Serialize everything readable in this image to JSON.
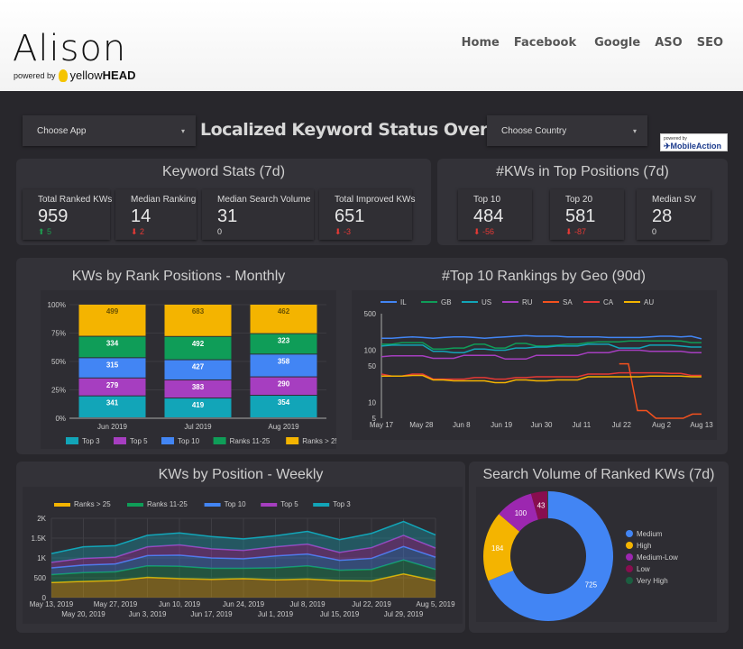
{
  "header": {
    "logo": "Alison",
    "powered_by": "powered by",
    "brand_light": "yellow",
    "brand_bold": "HEAD",
    "nav": [
      "Home",
      "Facebook",
      "Google",
      "ASO",
      "SEO"
    ]
  },
  "controls": {
    "choose_app": "Choose App",
    "title": "Localized Keyword Status Overview",
    "choose_country": "Choose Country",
    "caret": "▾",
    "badge_small": "powered by",
    "badge": "MobileAction"
  },
  "keyword_stats": {
    "title": "Keyword Stats (7d)",
    "cards": [
      {
        "label": "Total Ranked KWs",
        "value": "959",
        "delta": "5",
        "dir": "up"
      },
      {
        "label": "Median Ranking",
        "value": "14",
        "delta": "2",
        "dir": "down"
      },
      {
        "label": "Median Search Volume",
        "value": "31",
        "delta": "0",
        "dir": "neutral"
      },
      {
        "label": "Total Improved KWs",
        "value": "651",
        "delta": "-3",
        "dir": "down"
      }
    ]
  },
  "top_positions": {
    "title": "#KWs in Top Positions (7d)",
    "cards": [
      {
        "label": "Top 10",
        "value": "484",
        "delta": "-56",
        "dir": "down"
      },
      {
        "label": "Top 20",
        "value": "581",
        "delta": "-87",
        "dir": "down"
      },
      {
        "label": "Median SV",
        "value": "28",
        "delta": "0",
        "dir": "neutral"
      }
    ]
  },
  "titles": {
    "monthly": "KWs by Rank Positions - Monthly",
    "geo": "#Top 10 Rankings by Geo (90d)",
    "weekly": "KWs by Position - Weekly",
    "sv": "Search Volume of Ranked KWs (7d)"
  },
  "chart_data": [
    {
      "type": "bar",
      "stacked": "percent",
      "title": "KWs by Rank Positions - Monthly",
      "categories": [
        "Jun 2019",
        "Jul 2019",
        "Aug 2019"
      ],
      "yticks": [
        "0%",
        "25%",
        "50%",
        "75%",
        "100%"
      ],
      "series": [
        {
          "name": "Top 3",
          "color": "#12a5b8",
          "values": [
            341,
            419,
            354
          ]
        },
        {
          "name": "Top 5",
          "color": "#a63ec0",
          "values": [
            279,
            383,
            290
          ]
        },
        {
          "name": "Top 10",
          "color": "#4285f4",
          "values": [
            315,
            427,
            358
          ]
        },
        {
          "name": "Ranks 11-25",
          "color": "#0f9d58",
          "values": [
            334,
            492,
            323
          ]
        },
        {
          "name": "Ranks > 25",
          "color": "#f4b400",
          "values": [
            499,
            683,
            462
          ]
        }
      ],
      "legend": "bottom"
    },
    {
      "type": "line",
      "title": "#Top 10 Rankings by Geo (90d)",
      "yscale": "log",
      "ylim": [
        5,
        500
      ],
      "yticks": [
        5,
        10,
        50,
        100,
        500
      ],
      "xticks": [
        "May 17",
        "May 28",
        "Jun 8",
        "Jun 19",
        "Jun 30",
        "Jul 11",
        "Jul 22",
        "Aug 2",
        "Aug 13"
      ],
      "series": [
        {
          "name": "IL",
          "color": "#4285f4",
          "values": [
            170,
            170,
            175,
            180,
            175,
            170,
            175,
            180,
            180,
            175,
            170,
            175,
            180,
            185,
            190,
            185,
            185,
            185,
            180,
            180,
            180,
            180,
            175,
            175,
            175,
            175,
            180,
            185,
            185,
            180,
            185,
            165
          ]
        },
        {
          "name": "GB",
          "color": "#0f9d58",
          "values": [
            130,
            130,
            140,
            140,
            140,
            105,
            105,
            110,
            110,
            130,
            130,
            110,
            110,
            135,
            135,
            120,
            120,
            125,
            130,
            130,
            140,
            145,
            145,
            145,
            150,
            150,
            150,
            150,
            150,
            150,
            140,
            140
          ]
        },
        {
          "name": "US",
          "color": "#12a5b8",
          "values": [
            120,
            125,
            125,
            125,
            125,
            95,
            95,
            90,
            90,
            105,
            105,
            100,
            100,
            110,
            110,
            115,
            115,
            120,
            120,
            120,
            130,
            130,
            130,
            110,
            110,
            110,
            125,
            125,
            125,
            120,
            115,
            115
          ]
        },
        {
          "name": "RU",
          "color": "#a63ec0",
          "values": [
            75,
            78,
            78,
            78,
            78,
            70,
            70,
            70,
            80,
            80,
            80,
            80,
            68,
            68,
            68,
            80,
            80,
            80,
            80,
            80,
            90,
            90,
            90,
            100,
            100,
            100,
            95,
            95,
            95,
            95,
            90,
            90
          ]
        },
        {
          "name": "SA",
          "color": "#f4511e",
          "values": [
            null,
            null,
            null,
            null,
            null,
            null,
            null,
            null,
            null,
            null,
            null,
            null,
            null,
            null,
            null,
            null,
            null,
            null,
            null,
            null,
            null,
            null,
            null,
            null,
            null,
            null,
            55,
            55,
            7,
            7,
            5,
            5,
            5,
            5,
            6,
            6
          ]
        },
        {
          "name": "CA",
          "color": "#e53935",
          "values": [
            35,
            32,
            32,
            35,
            35,
            28,
            28,
            28,
            28,
            30,
            30,
            28,
            28,
            30,
            30,
            31,
            31,
            31,
            31,
            31,
            35,
            35,
            35,
            37,
            37,
            37,
            37,
            37,
            36,
            36,
            33,
            33
          ]
        },
        {
          "name": "AU",
          "color": "#f4b400",
          "values": [
            32,
            32,
            32,
            33,
            33,
            27,
            27,
            26,
            26,
            26,
            26,
            24,
            24,
            27,
            27,
            26,
            26,
            27,
            27,
            27,
            31,
            31,
            31,
            31,
            31,
            31,
            32,
            32,
            32,
            32,
            31,
            31
          ]
        }
      ],
      "legend": "top"
    },
    {
      "type": "area",
      "stacked": true,
      "title": "KWs by Position - Weekly",
      "x": [
        "May 13, 2019",
        "May 20, 2019",
        "May 27, 2019",
        "Jun 3, 2019",
        "Jun 10, 2019",
        "Jun 17, 2019",
        "Jun 24, 2019",
        "Jul 1, 2019",
        "Jul 8, 2019",
        "Jul 15, 2019",
        "Jul 22, 2019",
        "Jul 29, 2019",
        "Aug 5, 2019"
      ],
      "ylim": [
        0,
        2000
      ],
      "yticks": [
        "0",
        "500",
        "1K",
        "1.5K",
        "2K"
      ],
      "series": [
        {
          "name": "Ranks > 25",
          "color": "#f4b400",
          "values": [
            380,
            410,
            430,
            510,
            480,
            460,
            480,
            450,
            470,
            430,
            420,
            600,
            430
          ]
        },
        {
          "name": "Ranks 11-25",
          "color": "#0f9d58",
          "values": [
            200,
            220,
            220,
            290,
            310,
            280,
            260,
            300,
            330,
            260,
            290,
            350,
            280
          ]
        },
        {
          "name": "Top 10",
          "color": "#4285f4",
          "values": [
            170,
            190,
            200,
            260,
            280,
            260,
            240,
            300,
            300,
            250,
            280,
            340,
            310
          ]
        },
        {
          "name": "Top 5",
          "color": "#a63ec0",
          "values": [
            140,
            170,
            170,
            220,
            260,
            230,
            210,
            230,
            250,
            200,
            270,
            280,
            230
          ]
        },
        {
          "name": "Top 3",
          "color": "#12a5b8",
          "values": [
            220,
            290,
            290,
            290,
            300,
            310,
            290,
            280,
            320,
            320,
            360,
            350,
            330
          ]
        }
      ],
      "legend": "top"
    },
    {
      "type": "pie",
      "donut": true,
      "title": "Search Volume of Ranked KWs (7d)",
      "categories": [
        "Medium",
        "High",
        "Medium-Low",
        "Low",
        "Very High"
      ],
      "values": [
        725,
        184,
        100,
        43,
        2
      ],
      "colors": [
        "#4285f4",
        "#f4b400",
        "#9c27b0",
        "#880e4f",
        "#1b5e40"
      ],
      "legend": "right"
    }
  ]
}
